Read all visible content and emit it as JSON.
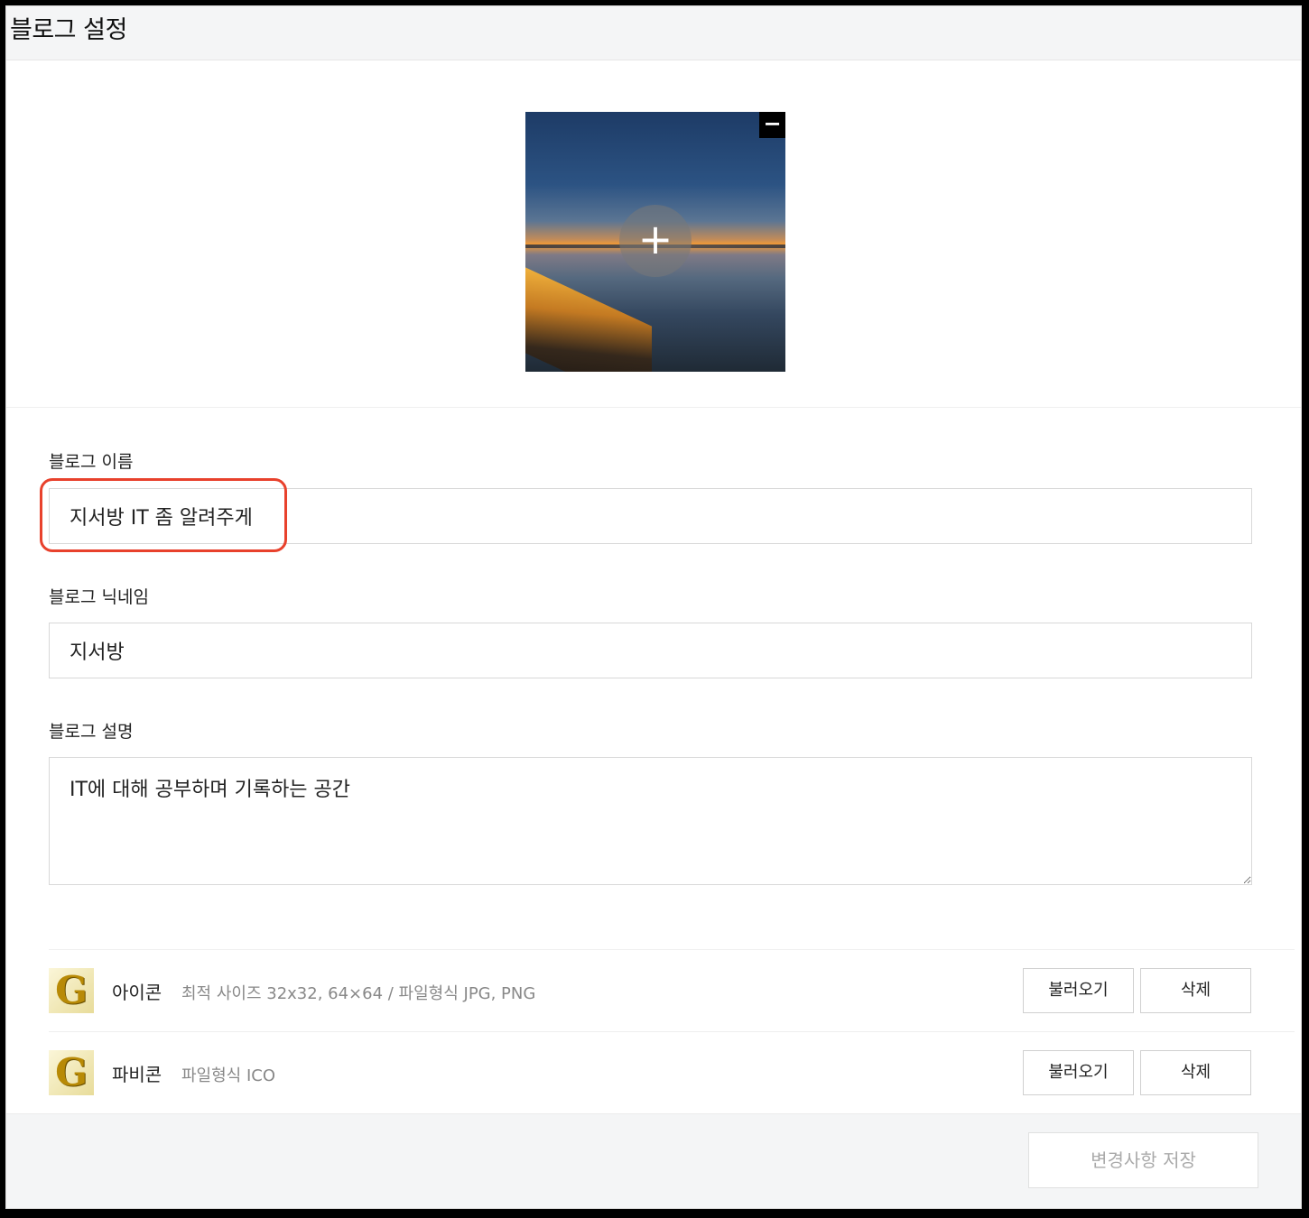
{
  "page": {
    "title": "블로그 설정"
  },
  "cover": {
    "add_symbol": "+",
    "remove_symbol": "−"
  },
  "fields": {
    "name": {
      "label": "블로그 이름",
      "value": "지서방 IT 좀 알려주게"
    },
    "nickname": {
      "label": "블로그 닉네임",
      "value": "지서방"
    },
    "description": {
      "label": "블로그 설명",
      "value": "IT에 대해 공부하며 기록하는 공간"
    }
  },
  "assets": [
    {
      "title": "아이콘",
      "desc": "최적 사이즈 32x32, 64×64 / 파일형식 JPG, PNG",
      "glyph": "G",
      "load_label": "불러오기",
      "delete_label": "삭제"
    },
    {
      "title": "파비콘",
      "desc": "파일형식 ICO",
      "glyph": "G",
      "load_label": "불러오기",
      "delete_label": "삭제"
    }
  ],
  "footer": {
    "save_label": "변경사항 저장"
  },
  "colors": {
    "highlight": "#e8412c",
    "title_bar": "#f4f5f6"
  }
}
